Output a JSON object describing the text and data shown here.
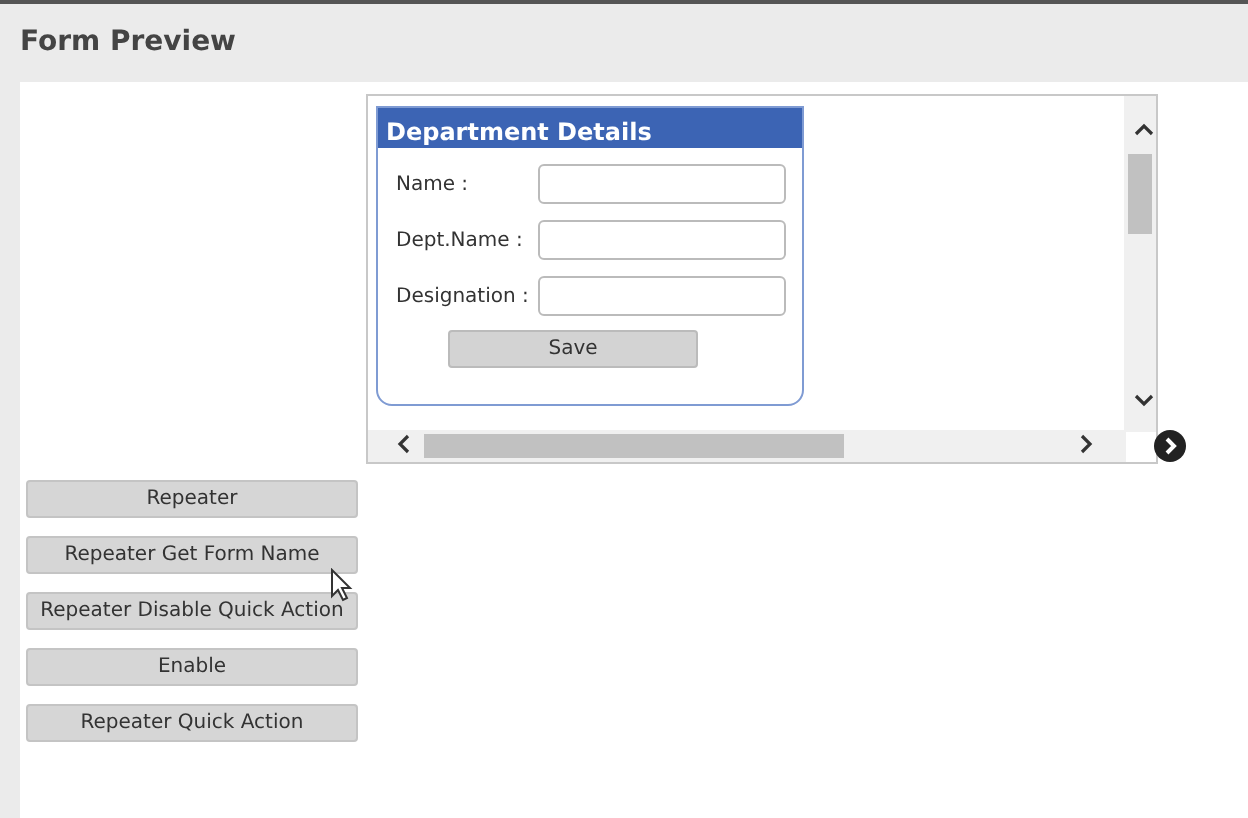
{
  "page": {
    "title": "Form Preview"
  },
  "form": {
    "title": "Department Details",
    "fields": [
      {
        "label": "Name :"
      },
      {
        "label": "Dept.Name :"
      },
      {
        "label": "Designation :"
      }
    ],
    "submit": "Save"
  },
  "buttons": [
    {
      "label": "Repeater"
    },
    {
      "label": "Repeater Get Form Name"
    },
    {
      "label": "Repeater Disable Quick Action"
    },
    {
      "label": "Enable"
    },
    {
      "label": "Repeater Quick Action"
    }
  ]
}
